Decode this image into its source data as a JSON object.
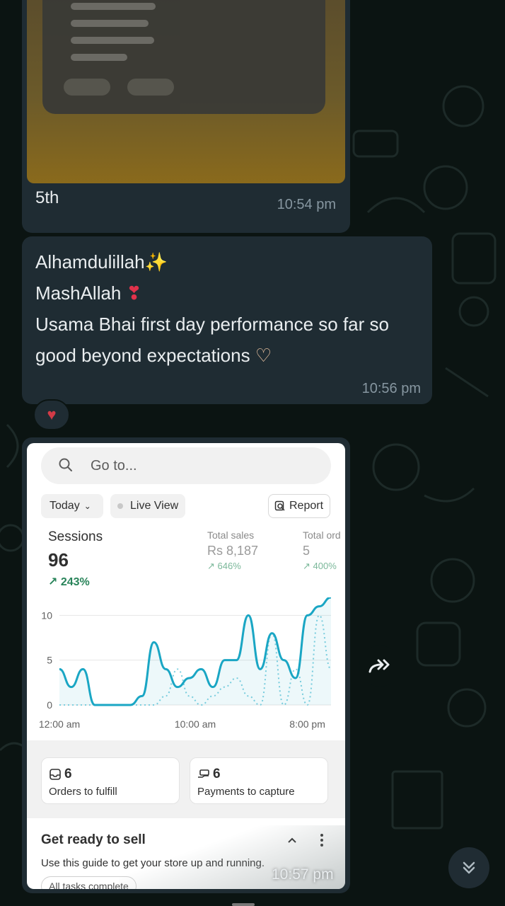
{
  "messages": {
    "image_message": {
      "caption": "5th",
      "time": "10:54 pm"
    },
    "text_message": {
      "line1": "Alhamdulillah",
      "line2": "MashAllah",
      "line3": "Usama Bhai first day performance so far so good beyond expectations",
      "time": "10:56 pm"
    },
    "reaction_icon": "anatomical-heart-emoji",
    "dashboard_message": {
      "time": "10:57 pm"
    }
  },
  "dashboard": {
    "search_placeholder": "Go to...",
    "filter_today": "Today",
    "live_view": "Live View",
    "report": "Report",
    "sessions": {
      "label": "Sessions",
      "value": "96",
      "delta": "243%"
    },
    "total_sales": {
      "label": "Total sales",
      "value": "Rs 8,187",
      "delta": "646%"
    },
    "total_orders": {
      "label": "Total ord",
      "value": "5",
      "delta": "400%"
    },
    "orders_card": {
      "count": "6",
      "label": "Orders to fulfill"
    },
    "payments_card": {
      "count": "6",
      "label": "Payments to capture"
    },
    "guide": {
      "title": "Get ready to sell",
      "subtitle": "Use this guide to get your store up and running.",
      "pill": "All tasks complete"
    }
  },
  "chart_data": {
    "type": "line",
    "y_ticks": [
      "10",
      "5",
      "0"
    ],
    "ylim": [
      0,
      12
    ],
    "x_tick_labels": [
      "12:00 am",
      "10:00 am",
      "8:00 pm"
    ],
    "x": [
      0,
      1,
      2,
      3,
      4,
      5,
      6,
      7,
      8,
      9,
      10,
      11,
      12,
      13,
      14,
      15,
      16,
      17,
      18,
      19,
      20,
      21,
      22,
      23
    ],
    "series": [
      {
        "values": [
          4,
          2,
          4,
          0,
          0,
          0,
          0,
          1,
          7,
          4,
          2,
          3,
          4,
          2,
          5,
          5,
          10,
          4,
          8,
          5,
          3,
          10,
          11,
          12
        ]
      },
      {
        "values": [
          0,
          0,
          0,
          0,
          0,
          0,
          0,
          0,
          0,
          1,
          4,
          1,
          0,
          1,
          2,
          3,
          1,
          0,
          8,
          0,
          4,
          0,
          10,
          4
        ]
      }
    ],
    "colors": {
      "primary": "#1aa6c4",
      "secondary": "#7fd0e0"
    },
    "grid": true
  },
  "chrome": {
    "forward_icon": "forward-arrow-icon",
    "scroll_down_icon": "double-chevron-down-icon"
  }
}
